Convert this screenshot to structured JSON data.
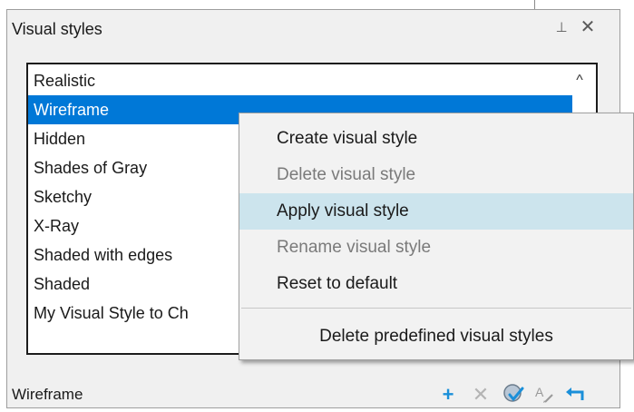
{
  "panel": {
    "title": "Visual styles",
    "pin_glyph": "⊥",
    "close_glyph": "✕"
  },
  "list": {
    "items": [
      {
        "label": "Realistic",
        "selected": false
      },
      {
        "label": "Wireframe",
        "selected": true
      },
      {
        "label": "Hidden",
        "selected": false
      },
      {
        "label": "Shades of Gray",
        "selected": false
      },
      {
        "label": "Sketchy",
        "selected": false
      },
      {
        "label": "X-Ray",
        "selected": false
      },
      {
        "label": "Shaded with edges",
        "selected": false
      },
      {
        "label": "Shaded",
        "selected": false
      },
      {
        "label": "My Visual Style to Ch",
        "selected": false
      }
    ],
    "scroll_up_glyph": "^"
  },
  "context_menu": {
    "items": [
      {
        "label": "Create visual style",
        "enabled": true,
        "highlighted": false
      },
      {
        "label": "Delete visual style",
        "enabled": false,
        "highlighted": false
      },
      {
        "label": "Apply visual style",
        "enabled": true,
        "highlighted": true
      },
      {
        "label": "Rename visual style",
        "enabled": false,
        "highlighted": false
      },
      {
        "label": "Reset to default",
        "enabled": true,
        "highlighted": false
      },
      {
        "label": "Delete predefined visual styles",
        "enabled": true,
        "highlighted": false
      }
    ]
  },
  "footer": {
    "current_style": "Wireframe",
    "toolbar_icons": [
      "add-icon",
      "delete-icon",
      "apply-icon",
      "rename-icon",
      "undo-icon"
    ]
  },
  "colors": {
    "selection": "#0078d7",
    "menu_highlight": "#cce4ed",
    "add_icon": "#1a8fd9",
    "apply_icon": "#1a8fd9"
  }
}
